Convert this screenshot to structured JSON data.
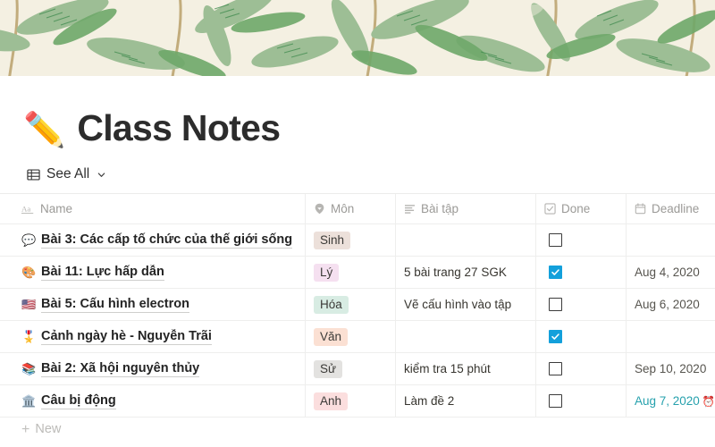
{
  "cover": {
    "name": "botanical-leaf-pattern-cover",
    "background_color": "#f4f0e2",
    "leaf_colors": [
      "#9dbe95",
      "#6fa86a",
      "#3f8a4e",
      "#b9a06a"
    ]
  },
  "header": {
    "emoji": "✏️",
    "title": "Class Notes"
  },
  "view_bar": {
    "icon": "table-icon",
    "label": "See All",
    "chevron": "chevron-down-icon"
  },
  "table": {
    "columns": [
      {
        "key": "name",
        "label": "Name",
        "icon": "aa-text-icon"
      },
      {
        "key": "mon",
        "label": "Môn",
        "icon": "tag-select-icon"
      },
      {
        "key": "baitap",
        "label": "Bài tập",
        "icon": "text-lines-icon"
      },
      {
        "key": "done",
        "label": "Done",
        "icon": "checkbox-icon"
      },
      {
        "key": "deadline",
        "label": "Deadline",
        "icon": "calendar-icon"
      }
    ],
    "rows": [
      {
        "emoji": "💬",
        "name": "Bài 3: Các cấp tố chức của thế giới sống",
        "mon": "Sinh",
        "mon_bg": "#ece0da",
        "baitap": "",
        "done": false,
        "deadline": "",
        "deadline_accent": false,
        "deadline_alarm": false
      },
      {
        "emoji": "🎨",
        "name": "Bài 11: Lực hấp dẫn",
        "mon": "Lý",
        "mon_bg": "#f5e0f0",
        "baitap": "5 bài trang 27 SGK",
        "done": true,
        "deadline": "Aug 4, 2020",
        "deadline_accent": false,
        "deadline_alarm": false
      },
      {
        "emoji": "🇺🇸",
        "name": "Bài 5: Cấu hình electron",
        "mon": "Hóa",
        "mon_bg": "#d8ece3",
        "baitap": "Vẽ cấu hình vào tập",
        "done": false,
        "deadline": "Aug 6, 2020",
        "deadline_accent": false,
        "deadline_alarm": false
      },
      {
        "emoji": "🎖️",
        "name": "Cảnh ngày hè - Nguyễn Trãi",
        "mon": "Văn",
        "mon_bg": "#fbe0d3",
        "baitap": "",
        "done": true,
        "deadline": "",
        "deadline_accent": false,
        "deadline_alarm": false
      },
      {
        "emoji": "📚",
        "name": "Bài 2: Xã hội nguyên thủy",
        "mon": "Sử",
        "mon_bg": "#e3e2e0",
        "baitap": "kiểm tra 15 phút",
        "done": false,
        "deadline": "Sep 10, 2020",
        "deadline_accent": false,
        "deadline_alarm": false
      },
      {
        "emoji": "🏛️",
        "name": "Câu bị động",
        "mon": "Anh",
        "mon_bg": "#fbdede",
        "baitap": "Làm đề 2",
        "done": false,
        "deadline": "Aug 7, 2020",
        "deadline_accent": true,
        "deadline_alarm": true,
        "deadline_alarm_emoji": "⏰"
      }
    ]
  },
  "new_row": {
    "plus": "+",
    "label": "New"
  },
  "colors": {
    "checkbox_checked": "#13a0db",
    "accent_date": "#26a1ad",
    "header_text": "#9b9a97"
  }
}
